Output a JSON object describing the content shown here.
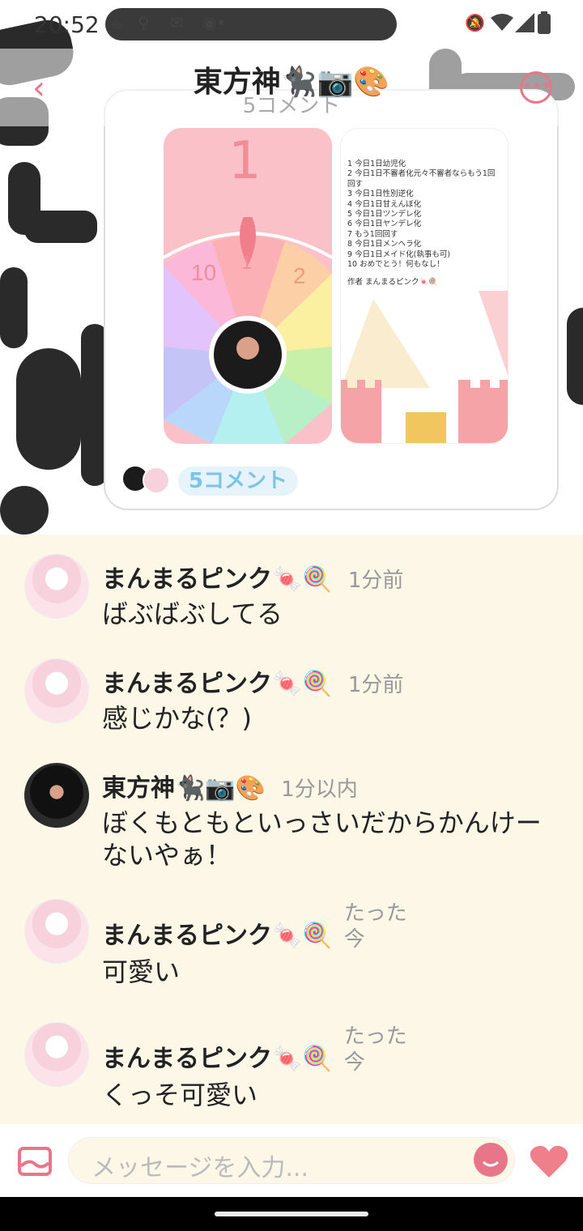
{
  "status": {
    "time": "20:52",
    "left_icons": [
      "coffee-icon",
      "scooter-icon",
      "mail-icon",
      "app-icon"
    ],
    "right_icons": [
      "bell-off-icon",
      "wifi-icon",
      "signal-icon",
      "battery-icon"
    ]
  },
  "header": {
    "title": "東方神🐈‍⬛📷🎨",
    "subtitle": "5コメント"
  },
  "post": {
    "screenshot_left": {
      "numbers": [
        "1",
        "2",
        "10",
        "1"
      ]
    },
    "screenshot_right": {
      "list": [
        "1 今日1日幼児化",
        "2 今日1日不審者化元々不審者ならもう1回回す",
        "3 今日1日性別逆化",
        "4 今日1日甘えんぼ化",
        "5 今日1日ツンデレ化",
        "6 今日1日ヤンデレ化",
        "7 もう1回回す",
        "8 今日1日メンヘラ化",
        "9 今日1日メイド化(執事も可)",
        "10 おめでとう！何もなし！",
        "作者 まんまるピンク🍬🍭"
      ]
    },
    "comment_chip": "5コメント"
  },
  "comments": [
    {
      "name": "まんまるピンク🍬🍭",
      "time": "1分前",
      "text": "ばぶばぶしてる",
      "avatar": "pink"
    },
    {
      "name": "まんまるピンク🍬🍭",
      "time": "1分前",
      "text": "感じかな(？)",
      "avatar": "pink"
    },
    {
      "name": "東方神🐈‍⬛📷🎨",
      "time": "1分以内",
      "text": "ぼくもともといっさいだからかんけーないやぁ！",
      "avatar": "dark"
    },
    {
      "name": "まんまるピンク🍬🍭",
      "time": "たった今",
      "text": "可愛い",
      "avatar": "pink"
    },
    {
      "name": "まんまるピンク🍬🍭",
      "time": "たった今",
      "text": "くっそ可愛い",
      "avatar": "pink"
    }
  ],
  "input": {
    "placeholder": "メッセージを入力..."
  },
  "colors": {
    "accent": "#e8768a",
    "background": "#fdf7e8",
    "chip": "#7cc3e8"
  }
}
